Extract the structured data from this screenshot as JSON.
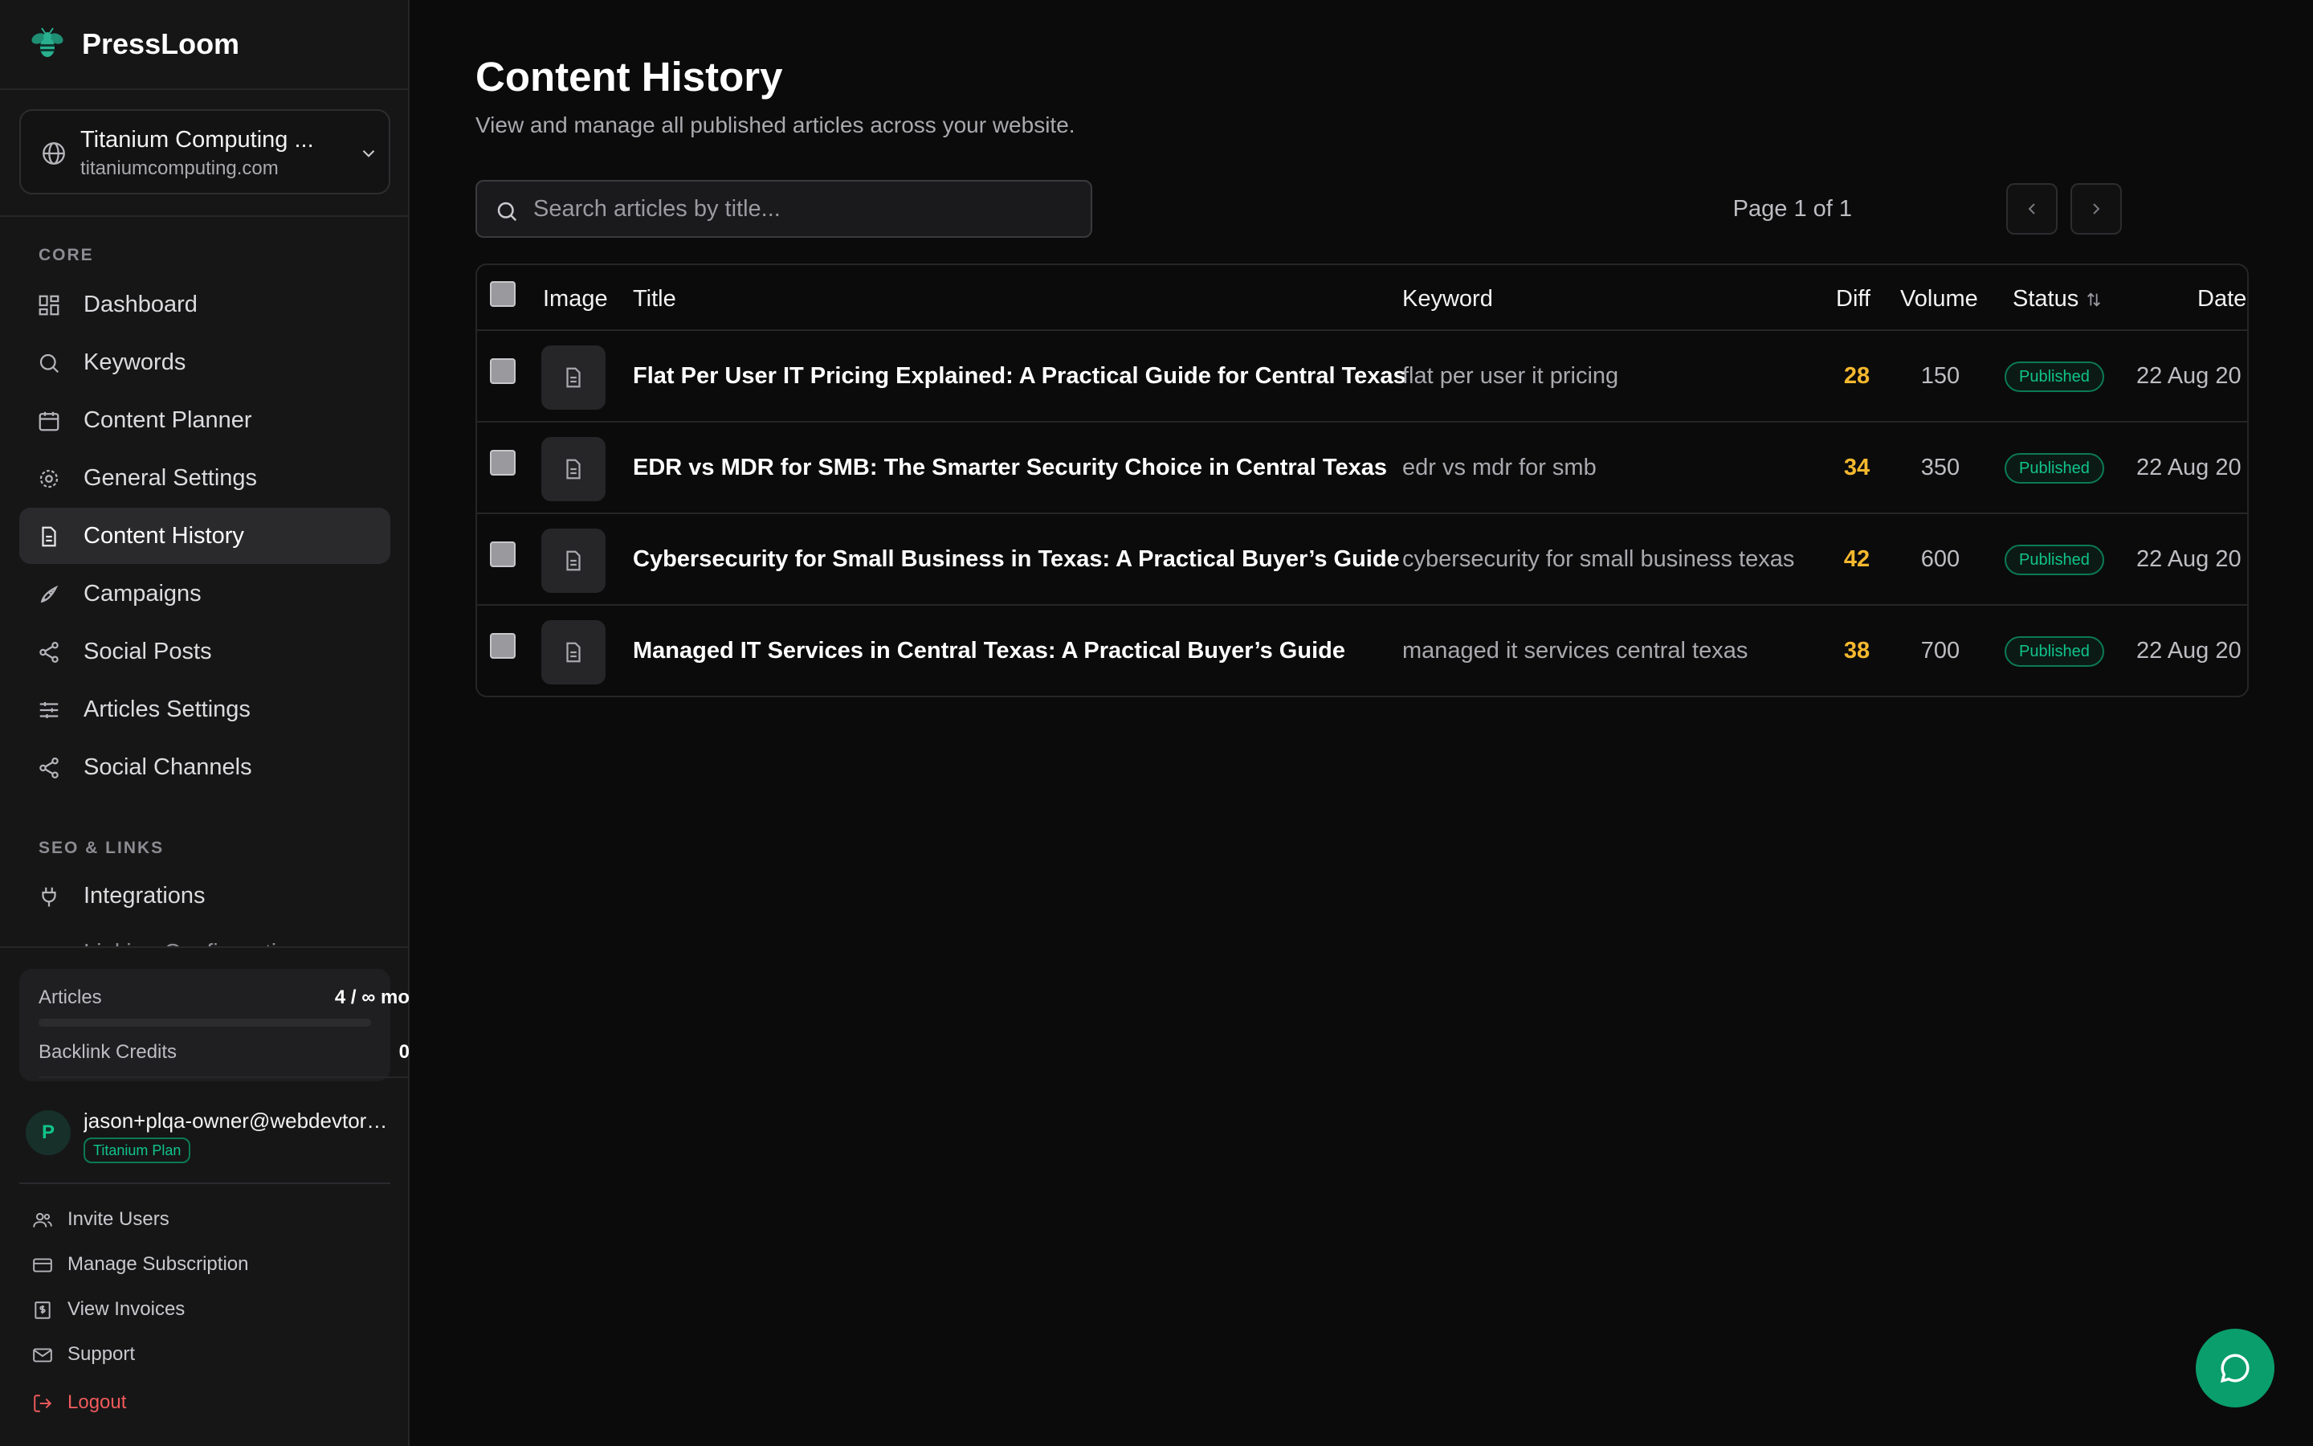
{
  "app": {
    "brand": "PressLoom"
  },
  "site": {
    "name": "Titanium Computing ...",
    "url": "titaniumcomputing.com"
  },
  "sidebar": {
    "section_core": "CORE",
    "core_items": [
      {
        "label": "Dashboard",
        "icon": "dashboard-icon"
      },
      {
        "label": "Keywords",
        "icon": "search-icon"
      },
      {
        "label": "Content Planner",
        "icon": "calendar-icon"
      },
      {
        "label": "General Settings",
        "icon": "gear-icon"
      },
      {
        "label": "Content History",
        "icon": "document-icon",
        "active": true
      },
      {
        "label": "Campaigns",
        "icon": "rocket-icon"
      },
      {
        "label": "Social Posts",
        "icon": "share-icon"
      },
      {
        "label": "Articles Settings",
        "icon": "sliders-icon"
      },
      {
        "label": "Social Channels",
        "icon": "share-icon"
      }
    ],
    "section_seo": "SEO & LINKS",
    "seo_items": [
      {
        "label": "Integrations",
        "icon": "plug-icon"
      }
    ],
    "clipped_item": "Linking Configuration"
  },
  "usage": {
    "articles_label": "Articles",
    "articles_value": "4 / ∞ mo",
    "backlink_label": "Backlink Credits",
    "backlink_value": "0",
    "articles_progress_fraction": 0
  },
  "user": {
    "initial": "P",
    "email": "jason+plqa-owner@webdevtoronto.com",
    "plan": "Titanium Plan"
  },
  "bottom_menu": [
    {
      "label": "Invite Users",
      "icon": "users-icon"
    },
    {
      "label": "Manage Subscription",
      "icon": "credit-card-icon"
    },
    {
      "label": "View Invoices",
      "icon": "invoice-icon"
    },
    {
      "label": "Support",
      "icon": "mail-icon"
    },
    {
      "label": "Logout",
      "icon": "logout-icon"
    }
  ],
  "main": {
    "title": "Content History",
    "subtitle": "View and manage all published articles across your website.",
    "search_placeholder": "Search articles by title...",
    "pager_text": "Page 1 of 1"
  },
  "table": {
    "columns": {
      "image": "Image",
      "title": "Title",
      "keyword": "Keyword",
      "diff": "Diff",
      "volume": "Volume",
      "status": "Status",
      "date": "Date"
    },
    "rows": [
      {
        "title": "Flat Per User IT Pricing Explained: A Practical Guide for Central Texas",
        "keyword": "flat per user it pricing",
        "diff": "28",
        "volume": "150",
        "status": "Published",
        "date": "22 Aug 20"
      },
      {
        "title": "EDR vs MDR for SMB: The Smarter Security Choice in Central Texas",
        "keyword": "edr vs mdr for smb",
        "diff": "34",
        "volume": "350",
        "status": "Published",
        "date": "22 Aug 20"
      },
      {
        "title": "Cybersecurity for Small Business in Texas: A Practical Buyer’s Guide",
        "keyword": "cybersecurity for small business texas",
        "diff": "42",
        "volume": "600",
        "status": "Published",
        "date": "22 Aug 20"
      },
      {
        "title": "Managed IT Services in Central Texas: A Practical Buyer’s Guide",
        "keyword": "managed it services central texas",
        "diff": "38",
        "volume": "700",
        "status": "Published",
        "date": "22 Aug 20"
      }
    ]
  },
  "colors": {
    "accent": "#0a9e6c",
    "diff": "#f5b82e",
    "logout": "#ef5a5a",
    "background": "#0b0b0c",
    "sidebar": "#161617"
  }
}
